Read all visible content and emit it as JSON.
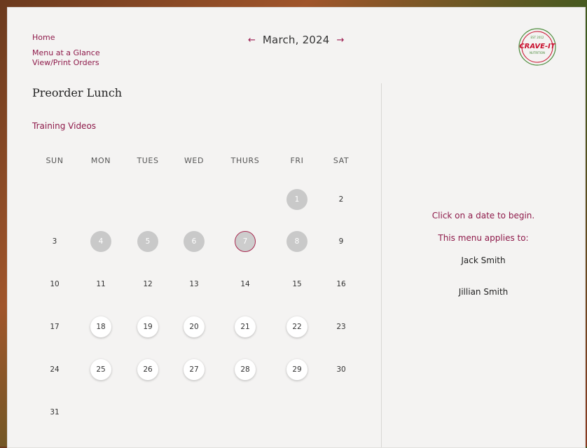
{
  "nav": {
    "home": "Home",
    "menu_at_a_glance": "Menu at a Glance",
    "view_print_orders": "View/Print Orders"
  },
  "month_nav": {
    "prev_icon": "arrow-left-icon",
    "next_icon": "arrow-right-icon",
    "title": "March, 2024"
  },
  "logo": {
    "top_text": "EST 2012",
    "main_text": "CRAVE-IT",
    "sub_text": "NUTRITION"
  },
  "page_title": "Preorder Lunch",
  "training_videos": "Training Videos",
  "calendar": {
    "weekdays": [
      "SUN",
      "MON",
      "TUES",
      "WED",
      "THURS",
      "FRI",
      "SAT"
    ],
    "weeks": [
      [
        null,
        null,
        null,
        null,
        null,
        {
          "n": "1",
          "s": "past-available"
        },
        {
          "n": "2",
          "s": "plain"
        }
      ],
      [
        {
          "n": "3",
          "s": "plain"
        },
        {
          "n": "4",
          "s": "past-available"
        },
        {
          "n": "5",
          "s": "past-available"
        },
        {
          "n": "6",
          "s": "past-available"
        },
        {
          "n": "7",
          "s": "today"
        },
        {
          "n": "8",
          "s": "past-available"
        },
        {
          "n": "9",
          "s": "plain"
        }
      ],
      [
        {
          "n": "10",
          "s": "plain"
        },
        {
          "n": "11",
          "s": "plain"
        },
        {
          "n": "12",
          "s": "plain"
        },
        {
          "n": "13",
          "s": "plain"
        },
        {
          "n": "14",
          "s": "plain"
        },
        {
          "n": "15",
          "s": "plain"
        },
        {
          "n": "16",
          "s": "plain"
        }
      ],
      [
        {
          "n": "17",
          "s": "plain"
        },
        {
          "n": "18",
          "s": "available"
        },
        {
          "n": "19",
          "s": "available"
        },
        {
          "n": "20",
          "s": "available"
        },
        {
          "n": "21",
          "s": "available"
        },
        {
          "n": "22",
          "s": "available"
        },
        {
          "n": "23",
          "s": "plain"
        }
      ],
      [
        {
          "n": "24",
          "s": "plain"
        },
        {
          "n": "25",
          "s": "available"
        },
        {
          "n": "26",
          "s": "available"
        },
        {
          "n": "27",
          "s": "available"
        },
        {
          "n": "28",
          "s": "available"
        },
        {
          "n": "29",
          "s": "available"
        },
        {
          "n": "30",
          "s": "plain"
        }
      ],
      [
        {
          "n": "31",
          "s": "plain"
        },
        null,
        null,
        null,
        null,
        null,
        null
      ]
    ]
  },
  "side_panel": {
    "prompt": "Click on a date to begin.",
    "applies_to_label": "This menu applies to:",
    "students": [
      "Jack Smith",
      "Jillian Smith"
    ]
  },
  "colors": {
    "accent": "#8e1a4a",
    "logo_red": "#c8102e",
    "logo_green": "#4a8a3a"
  }
}
